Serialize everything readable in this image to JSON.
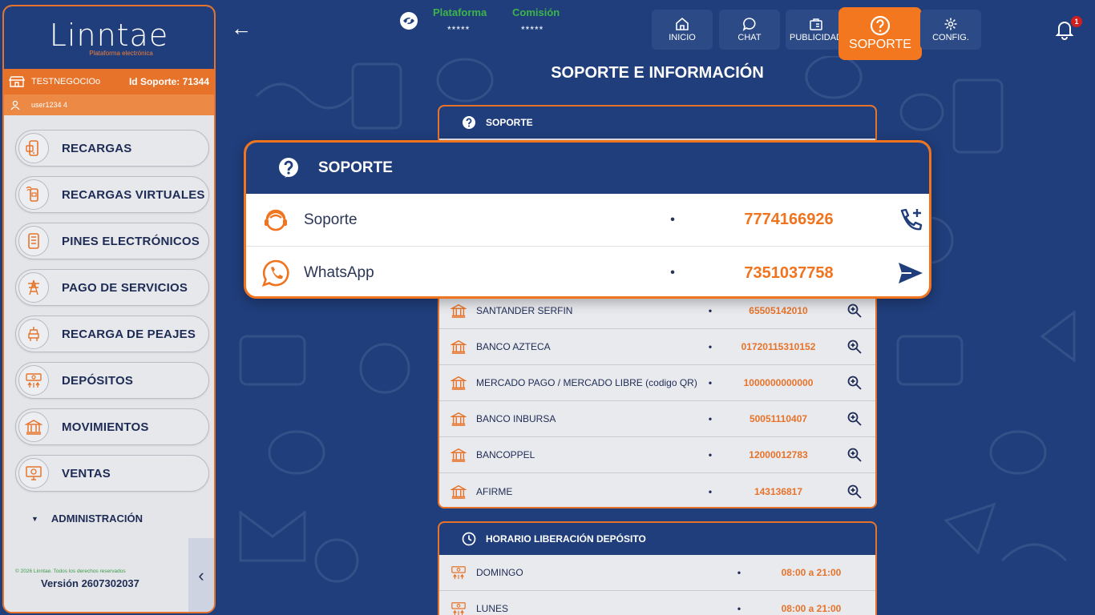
{
  "sidebar": {
    "logo": "Linntae",
    "logo_sub": "Plataforma electrónica",
    "business_name": "TESTNEGOCIOo",
    "support_id": "Id Soporte: 71344",
    "user": "user1234 4",
    "menu": [
      {
        "label": "RECARGAS",
        "icon": "recharge-icon"
      },
      {
        "label": "RECARGAS VIRTUALES",
        "icon": "virtual-recharge-icon"
      },
      {
        "label": "PINES ELECTRÓNICOS",
        "icon": "pin-icon"
      },
      {
        "label": "PAGO DE SERVICIOS",
        "icon": "service-tower-icon"
      },
      {
        "label": "RECARGA DE PEAJES",
        "icon": "toll-icon"
      },
      {
        "label": "DEPÓSITOS",
        "icon": "deposit-icon"
      },
      {
        "label": "MOVIMIENTOS",
        "icon": "bank-icon"
      },
      {
        "label": "VENTAS",
        "icon": "sales-icon"
      }
    ],
    "admin_label": "ADMINISTRACIÓN",
    "copyright": "© 2026 Linntae. Todos los derechos reservados",
    "version": "Versión 2607302037"
  },
  "header": {
    "plataforma_label": "Plataforma",
    "plataforma_value": "*****",
    "comision_label": "Comisión",
    "comision_value": "*****",
    "nav": [
      {
        "label": "INICIO",
        "icon": "home-icon"
      },
      {
        "label": "CHAT",
        "icon": "chat-icon"
      },
      {
        "label": "PUBLICIDAD",
        "icon": "ad-icon"
      },
      {
        "label": "SOPORTE",
        "icon": "help-icon"
      },
      {
        "label": "CONFIG.",
        "icon": "gear-icon"
      }
    ],
    "notifications": "1"
  },
  "page": {
    "title": "SOPORTE E INFORMACIÓN",
    "support_panel_title": "SOPORTE",
    "banks": [
      {
        "name": "SANTANDER SERFIN",
        "number": "65505142010"
      },
      {
        "name": "BANCO AZTECA",
        "number": "01720115310152"
      },
      {
        "name": "MERCADO PAGO / MERCADO LIBRE (codigo QR)",
        "number": "1000000000000"
      },
      {
        "name": "BANCO INBURSA",
        "number": "50051110407"
      },
      {
        "name": "BANCOPPEL",
        "number": "12000012783"
      },
      {
        "name": "AFIRME",
        "number": "143136817"
      }
    ],
    "schedule_title": "HORARIO LIBERACIÓN DEPÓSITO",
    "schedule": [
      {
        "day": "DOMINGO",
        "hours": "08:00 a 21:00"
      },
      {
        "day": "LUNES",
        "hours": "08:00 a 21:00"
      }
    ]
  },
  "overlay": {
    "title": "SOPORTE",
    "rows": [
      {
        "name": "Soporte",
        "number": "7774166926"
      },
      {
        "name": "WhatsApp",
        "number": "7351037758"
      }
    ]
  },
  "colors": {
    "navy": "#203e7c",
    "orange": "#f0731e",
    "green": "#3cb44a"
  }
}
